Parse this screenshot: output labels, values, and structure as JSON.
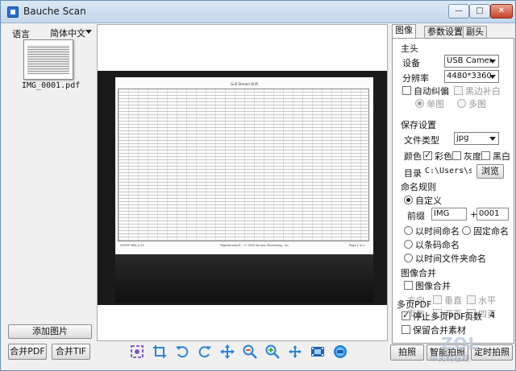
{
  "window": {
    "title": "Bauche Scan",
    "controls": {
      "minimize": "—",
      "maximize": "□",
      "close": "✕"
    }
  },
  "left": {
    "language_label": "语言",
    "language_value": "简体中文",
    "thumbnail_caption": "IMG_0001.pdf",
    "add_image_button": "添加图片",
    "merge_pdf_button": "合并PDF",
    "merge_tif_button": "合并TIF"
  },
  "document_preview": {
    "title": "Gulf Stream Drift",
    "footer_left": "ZOERY MKS_0.21",
    "footer_center": "PageGenesis® - © 1990 Serious Technology, Inc",
    "footer_right": "Page 1 of 1"
  },
  "toolbar": {
    "icons": [
      "focus-icon",
      "crop-icon",
      "rotate-left-icon",
      "rotate-right-icon",
      "move-icon",
      "zoom-out-icon",
      "zoom-in-icon",
      "fit-icon",
      "film-icon",
      "record-icon"
    ]
  },
  "right": {
    "tabs": [
      "图像",
      "参数设置",
      "副头"
    ],
    "main_camera": {
      "title": "主头",
      "device_label": "设备",
      "device_value": "USB Camera",
      "resolution_label": "分辨率",
      "resolution_value": "4480*3360",
      "auto_correct_label": "自动纠偏",
      "black_edge_label": "黑边补白",
      "single_label": "单图",
      "multi_label": "多图"
    },
    "save_settings": {
      "title": "保存设置",
      "file_type_label": "文件类型",
      "file_type_value": "jpg",
      "color_label": "颜色",
      "color_option": "彩色",
      "gray_option": "灰度",
      "bw_option": "黑白",
      "dir_label": "目录",
      "dir_value": "C:\\Users\\sd",
      "browse_button": "浏览"
    },
    "naming": {
      "title": "命名规则",
      "custom_label": "自定义",
      "prefix_label": "前缀",
      "prefix_value": "IMG",
      "plus": "+",
      "counter_value": "0001",
      "by_time": "以时间命名",
      "fixed_name": "固定命名",
      "by_barcode": "以条码命名",
      "by_time_folder": "以时间文件夹命名"
    },
    "merge": {
      "title": "图像合并",
      "merge_label": "图像合并",
      "direction_label": "方向",
      "vertical_label": "垂直",
      "horizontal_label": "水平",
      "pages_label": "页数",
      "two_pages": "两页",
      "four_pages": "四页"
    },
    "multipage_pdf": {
      "title": "多页PDF",
      "stop_label": "停止多页PDF",
      "pages_label": "页数",
      "pages_value": "4",
      "keep_label": "保留合并素材"
    },
    "shoot_button": "拍照",
    "smart_shoot_button": "智能拍照",
    "timed_shoot_button": "定时拍照"
  },
  "watermark": {
    "logo": "ZOL",
    "text": "中关村在线"
  },
  "colors": {
    "titlebar": "#c3d6ec",
    "accent": "#2a6fd0",
    "preview_bg": "#1a1a1a"
  }
}
